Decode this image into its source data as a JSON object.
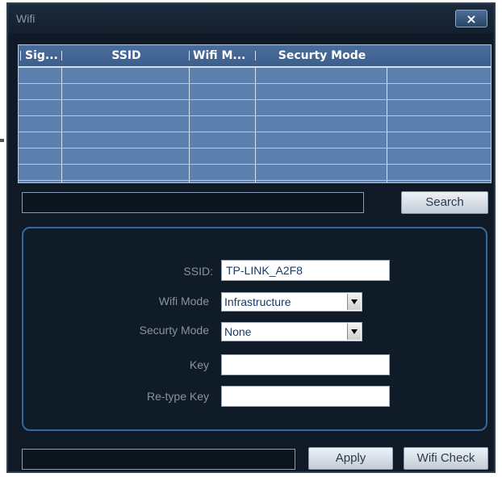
{
  "window": {
    "title": "Wifi",
    "close_label": "×"
  },
  "network_list": {
    "columns": [
      "Sig...",
      "SSID",
      "Wifi M...",
      "Securty Mode"
    ],
    "rows": [
      [
        "",
        "",
        "",
        ""
      ],
      [
        "",
        "",
        "",
        ""
      ],
      [
        "",
        "",
        "",
        ""
      ],
      [
        "",
        "",
        "",
        ""
      ],
      [
        "",
        "",
        "",
        ""
      ],
      [
        "",
        "",
        "",
        ""
      ],
      [
        "",
        "",
        "",
        ""
      ]
    ]
  },
  "search": {
    "status_value": "",
    "button_label": "Search"
  },
  "settings": {
    "ssid_label": "SSID:",
    "ssid_value": "TP-LINK_A2F8",
    "wifi_mode_label": "Wifi Mode",
    "wifi_mode_value": "Infrastructure",
    "security_mode_label": "Securty Mode",
    "security_mode_value": "None",
    "key_label": "Key",
    "key_value": "",
    "retype_key_label": "Re-type Key",
    "retype_key_value": ""
  },
  "footer": {
    "message_value": "",
    "apply_label": "Apply",
    "wifi_check_label": "Wifi Check"
  },
  "colors": {
    "window_bg": "#0f1a26",
    "list_bg": "#5c7fad",
    "panel_border": "#35699e",
    "field_text": "#1a3a66"
  }
}
